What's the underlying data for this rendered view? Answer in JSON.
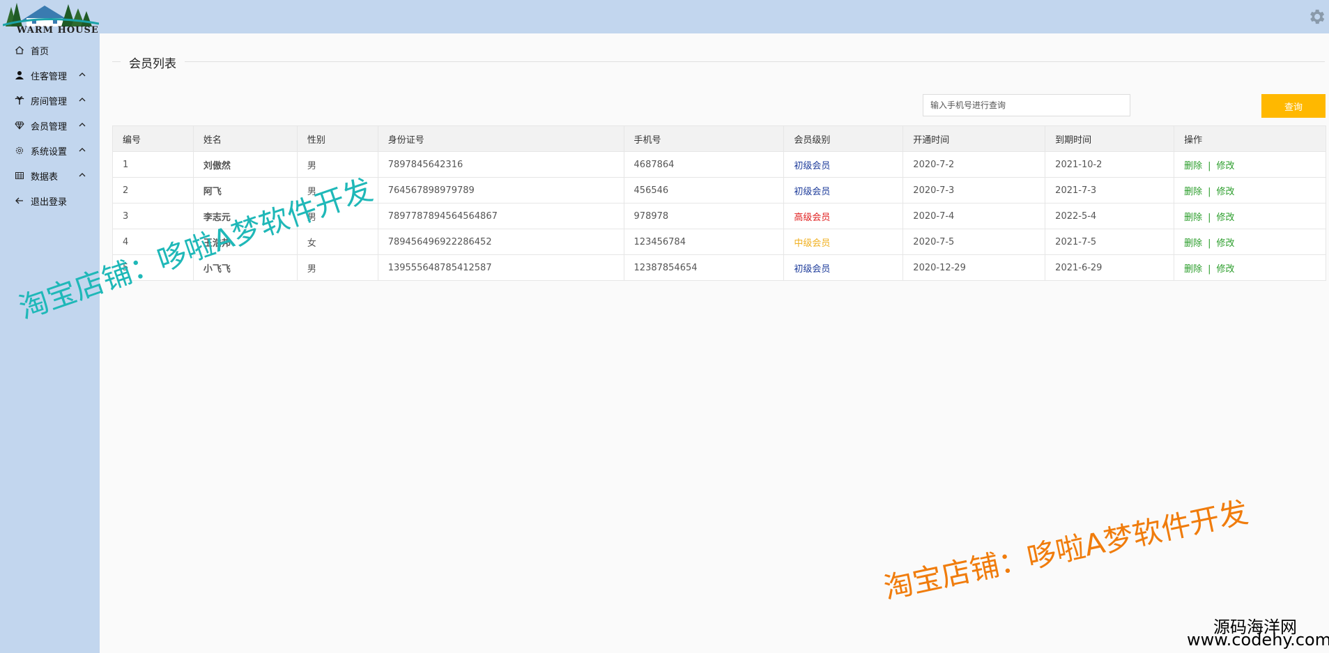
{
  "app": {
    "logo_text": "WARM HOUSE"
  },
  "sidebar": {
    "items": [
      {
        "label": "首页",
        "icon": "home-icon",
        "expandable": false
      },
      {
        "label": "住客管理",
        "icon": "user-icon",
        "expandable": true
      },
      {
        "label": "房间管理",
        "icon": "palm-icon",
        "expandable": true
      },
      {
        "label": "会员管理",
        "icon": "diamond-icon",
        "expandable": true
      },
      {
        "label": "系统设置",
        "icon": "gear-icon",
        "expandable": true
      },
      {
        "label": "数据表",
        "icon": "table-icon",
        "expandable": true
      },
      {
        "label": "退出登录",
        "icon": "arrow-left-icon",
        "expandable": false
      }
    ]
  },
  "page": {
    "title": "会员列表"
  },
  "search": {
    "placeholder": "输入手机号进行查询",
    "value": "",
    "button_label": "查询"
  },
  "table": {
    "headers": [
      "编号",
      "姓名",
      "性别",
      "身份证号",
      "手机号",
      "会员级别",
      "开通时间",
      "到期时间",
      "操作"
    ],
    "rows": [
      {
        "id": "1",
        "name": "刘傲然",
        "gender": "男",
        "id_card": "7897845642316",
        "phone": "4687864",
        "level": "初级会员",
        "level_color": "#1e3c9b",
        "start": "2020-7-2",
        "end": "2021-10-2"
      },
      {
        "id": "2",
        "name": "阿飞",
        "gender": "男",
        "id_card": "764567898979789",
        "phone": "456546",
        "level": "初级会员",
        "level_color": "#1e3c9b",
        "start": "2020-7-3",
        "end": "2021-7-3"
      },
      {
        "id": "3",
        "name": "李志元",
        "gender": "男",
        "id_card": "7897787894564564867",
        "phone": "978978",
        "level": "高级会员",
        "level_color": "#e02020",
        "start": "2020-7-4",
        "end": "2022-5-4"
      },
      {
        "id": "4",
        "name": "王浩邦",
        "gender": "女",
        "id_card": "789456496922286452",
        "phone": "123456784",
        "level": "中级会员",
        "level_color": "#f0b020",
        "start": "2020-7-5",
        "end": "2021-7-5"
      },
      {
        "id": "5",
        "name": "小飞飞",
        "gender": "男",
        "id_card": "139555648785412587",
        "phone": "12387854654",
        "level": "初级会员",
        "level_color": "#1e3c9b",
        "start": "2020-12-29",
        "end": "2021-6-29"
      }
    ],
    "actions": {
      "delete": "删除",
      "separator": "|",
      "edit": "修改"
    }
  },
  "watermarks": {
    "teal": "淘宝店铺：哆啦A梦软件开发",
    "orange": "淘宝店铺：哆啦A梦软件开发"
  },
  "corner": {
    "line1": "源码海洋网",
    "line2": "www.codehy.com"
  },
  "colors": {
    "sidebar_bg": "#c2d6ee",
    "accent_button": "#ffb800",
    "action_link": "#2a9d2a"
  }
}
